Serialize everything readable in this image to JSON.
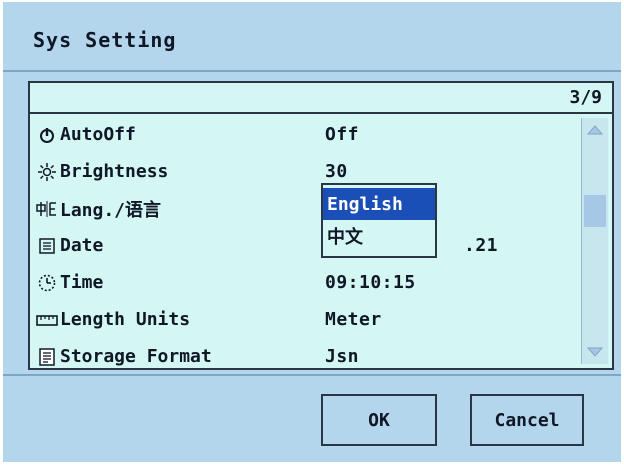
{
  "window": {
    "title": "Sys Setting"
  },
  "list": {
    "page_counter": "3/9",
    "items": [
      {
        "icon": "power-icon",
        "label": "AutoOff",
        "value": "Off"
      },
      {
        "icon": "brightness-icon",
        "label": "Brightness",
        "value": "30"
      },
      {
        "icon": "language-icon",
        "label": "Lang./语言",
        "value": "English"
      },
      {
        "icon": "calendar-icon",
        "label": "Date",
        "value": ".21"
      },
      {
        "icon": "clock-icon",
        "label": "Time",
        "value": "09:10:15"
      },
      {
        "icon": "ruler-icon",
        "label": "Length Units",
        "value": "Meter"
      },
      {
        "icon": "document-icon",
        "label": "Storage Format",
        "value": "Jsn"
      }
    ]
  },
  "language_dropdown": {
    "options": [
      "English",
      "中文"
    ],
    "selected": "English"
  },
  "buttons": {
    "ok": "OK",
    "cancel": "Cancel"
  },
  "colors": {
    "window_bg": "#b4d6ec",
    "panel_bg": "#d4f7f3",
    "selection": "#1b4fb8",
    "border": "#2a3545"
  }
}
